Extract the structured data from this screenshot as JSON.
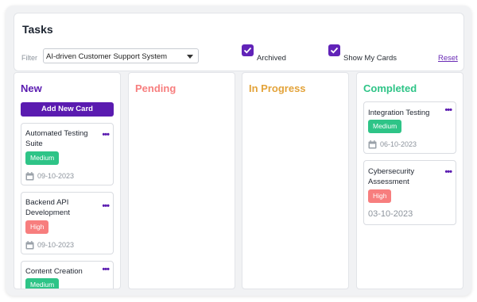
{
  "header": {
    "title": "Tasks",
    "filter_label": "Filter",
    "filter_value": "AI-driven Customer Support System",
    "archived_label": "Archived",
    "archived_checked": true,
    "show_my_cards_label": "Show My Cards",
    "show_my_cards_checked": true,
    "reset_label": "Reset"
  },
  "colors": {
    "accent": "#5a1bb0",
    "new": "#5a1bb0",
    "pending": "#f77e7e",
    "in_progress": "#e3a33a",
    "completed": "#2ec487",
    "medium": "#2ec487",
    "high": "#f77e7e"
  },
  "columns": {
    "new": {
      "title": "New",
      "add_button": "Add New Card",
      "cards": [
        {
          "title_line1": "Automated Testing",
          "title_line2": "Suite",
          "priority": "Medium",
          "date": "09-10-2023"
        },
        {
          "title_line1": "Backend API",
          "title_line2": "Development",
          "priority": "High",
          "date": "09-10-2023"
        },
        {
          "title_line1": "Content Creation",
          "title_line2": "",
          "priority": "Medium",
          "date": ""
        }
      ]
    },
    "pending": {
      "title": "Pending",
      "cards": []
    },
    "in_progress": {
      "title": "In Progress",
      "cards": []
    },
    "completed": {
      "title": "Completed",
      "cards": [
        {
          "title_line1": "Integration Testing",
          "priority": "Medium",
          "date": "06-10-2023"
        },
        {
          "title_line1": "Cybersecurity",
          "title_line2": "Assessment",
          "priority": "High",
          "date": "03-10-2023"
        }
      ]
    }
  },
  "icons": {
    "menu": "more-dots-icon",
    "calendar": "calendar-icon",
    "checkbox": "checkmark-icon",
    "dropdown": "chevron-down-icon"
  }
}
